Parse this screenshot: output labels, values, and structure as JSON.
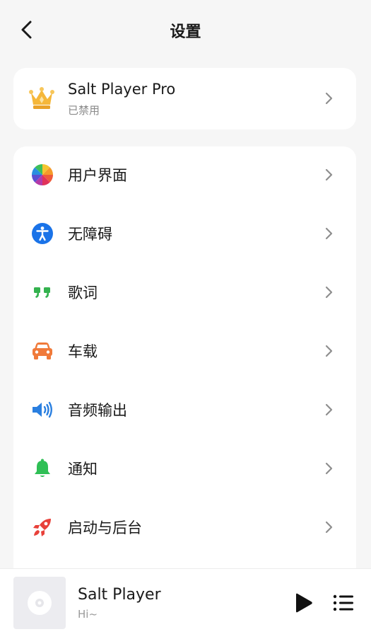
{
  "header": {
    "title": "设置"
  },
  "pro": {
    "title": "Salt Player Pro",
    "status": "已禁用"
  },
  "settings": {
    "items": [
      {
        "label": "用户界面",
        "icon": "color-wheel-icon"
      },
      {
        "label": "无障碍",
        "icon": "accessibility-icon"
      },
      {
        "label": "歌词",
        "icon": "quote-icon"
      },
      {
        "label": "车载",
        "icon": "car-icon"
      },
      {
        "label": "音频输出",
        "icon": "speaker-icon"
      },
      {
        "label": "通知",
        "icon": "bell-icon"
      },
      {
        "label": "启动与后台",
        "icon": "rocket-icon"
      }
    ]
  },
  "player": {
    "title": "Salt Player",
    "subtitle": "Hi~"
  },
  "colors": {
    "accessibility": "#1a73e8",
    "lyrics": "#34b24f",
    "car": "#f07a3a",
    "speaker": "#2a7fe0",
    "bell": "#2fbf55",
    "rocket": "#e8413a",
    "crown": "#f5b73a"
  }
}
